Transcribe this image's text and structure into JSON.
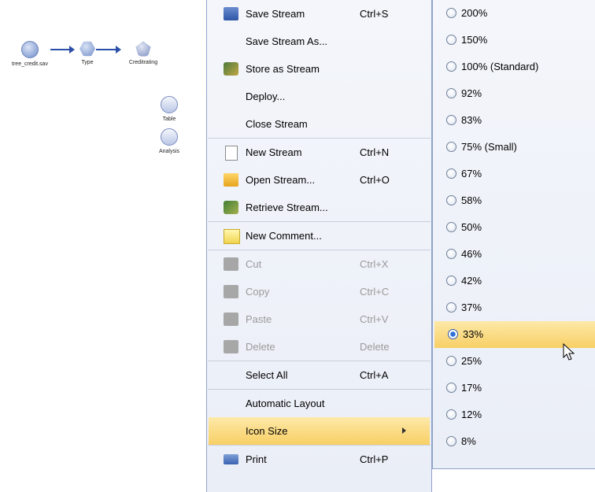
{
  "canvas": {
    "nodes": [
      {
        "label": "tree_credit.sav",
        "shape": "round-icon"
      },
      {
        "label": "Type",
        "shape": "hexagon-icon"
      },
      {
        "label": "Creditrating",
        "shape": "pentagon-icon"
      },
      {
        "label": "Table",
        "shape": "table-icon"
      },
      {
        "label": "Analysis",
        "shape": "magnifier-icon"
      }
    ]
  },
  "menu": {
    "items": [
      {
        "label": "Save Stream",
        "shortcut": "Ctrl+S"
      },
      {
        "label": "Save Stream As...",
        "shortcut": ""
      },
      {
        "label": "Store as Stream",
        "shortcut": ""
      },
      {
        "label": "Deploy...",
        "shortcut": ""
      },
      {
        "label": "Close Stream",
        "shortcut": ""
      },
      {
        "label": "New Stream",
        "shortcut": "Ctrl+N"
      },
      {
        "label": "Open Stream...",
        "shortcut": "Ctrl+O"
      },
      {
        "label": "Retrieve Stream...",
        "shortcut": ""
      },
      {
        "label": "New Comment...",
        "shortcut": ""
      },
      {
        "label": "Cut",
        "shortcut": "Ctrl+X"
      },
      {
        "label": "Copy",
        "shortcut": "Ctrl+C"
      },
      {
        "label": "Paste",
        "shortcut": "Ctrl+V"
      },
      {
        "label": "Delete",
        "shortcut": "Delete"
      },
      {
        "label": "Select All",
        "shortcut": "Ctrl+A"
      },
      {
        "label": "Automatic Layout",
        "shortcut": ""
      },
      {
        "label": "Icon Size",
        "shortcut": ""
      },
      {
        "label": "Print",
        "shortcut": "Ctrl+P"
      }
    ]
  },
  "submenu": {
    "options": [
      "200%",
      "150%",
      "100% (Standard)",
      "92%",
      "83%",
      "75% (Small)",
      "67%",
      "58%",
      "50%",
      "46%",
      "42%",
      "37%",
      "33%",
      "25%",
      "17%",
      "12%",
      "8%"
    ],
    "selected": "33%"
  },
  "colors": {
    "highlight": "#f8cf65",
    "menu_border": "#8fa3c8",
    "node_arrow": "#2b4ea8"
  }
}
